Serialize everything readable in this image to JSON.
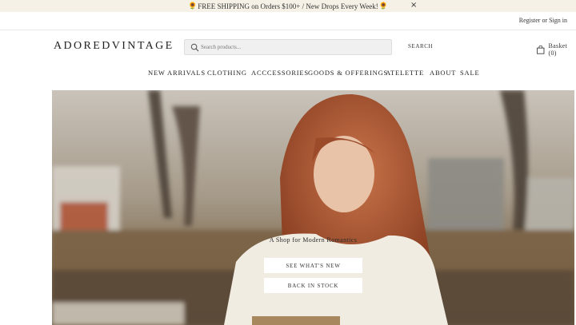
{
  "announcement": {
    "text": "FREE SHIPPING on Orders $100+ / New Drops Every Week!",
    "sun_glyph": "🌻",
    "close_glyph": "×"
  },
  "account": {
    "link_text": "Register or Sign in"
  },
  "header": {
    "logo": "ADOREDVINTAGE",
    "search_placeholder": "Search products...",
    "search_button": "SEARCH",
    "basket_label": "Basket (0)"
  },
  "nav": {
    "items": [
      {
        "label": "NEW ARRIVALS"
      },
      {
        "label": "CLOTHING"
      },
      {
        "label": "ACCCESSORIES"
      },
      {
        "label": "GOODS & OFFERINGS"
      },
      {
        "label": "ATELETTE"
      },
      {
        "label": "ABOUT"
      },
      {
        "label": "SALE"
      }
    ]
  },
  "hero": {
    "tagline": "A Shop for Modern Romantics",
    "button_primary": "SEE WHAT'S NEW",
    "button_secondary": "BACK IN STOCK"
  },
  "colors": {
    "announcement_bg": "#f6f1e6",
    "text": "#2b2b2b",
    "button_bg": "#ffffff"
  },
  "icons": [
    "sunflower-icon",
    "close-icon",
    "search-icon",
    "shopping-bag-icon"
  ]
}
